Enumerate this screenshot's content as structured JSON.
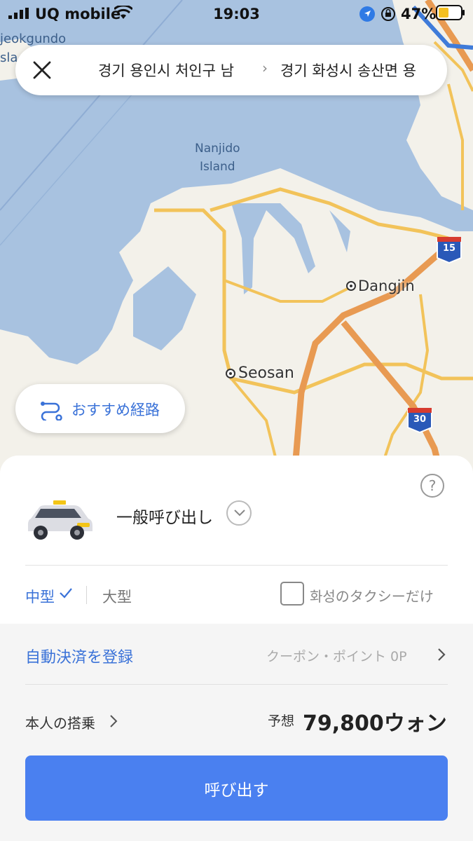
{
  "status_bar": {
    "carrier": "UQ mobile",
    "time": "19:03",
    "battery": "47%"
  },
  "route": {
    "origin": "경기 용인시 처인구 남",
    "destination": "경기 화성시 송산면 용"
  },
  "map": {
    "labels": {
      "top_left": "jeokgundo",
      "top_left2": "sla",
      "island_line1": "Nanjido",
      "island_line2": "Island",
      "city1": "Dangjin",
      "city2": "Seosan",
      "highway_15": "15",
      "highway_30": "30"
    }
  },
  "recommended_route": {
    "label": "おすすめ経路"
  },
  "sheet": {
    "help_icon": "?",
    "call_type": "一般呼び出し",
    "size_medium": "中型",
    "size_large": "大型",
    "local_only": "화성のタクシーだけ",
    "auto_pay": "自動決済を登録",
    "coupon": "クーポン・ポイント 0P",
    "self_ride": "本人の搭乗",
    "estimate_label": "予想",
    "price": "79,800ウォン",
    "call_button": "呼び出す"
  },
  "colors": {
    "accent": "#4a80f0",
    "link": "#3a72d8",
    "water": "#a8c2e0",
    "land": "#f3f1ea"
  }
}
